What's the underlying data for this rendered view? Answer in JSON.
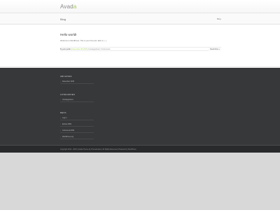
{
  "header": {
    "logo_main": "Avad",
    "logo_accent": "a"
  },
  "page_title_bar": {
    "title": "Blog",
    "breadcrumb": "Blog"
  },
  "post": {
    "title": "Hello world!",
    "excerpt": "Welcome to WordPress. This is your first post. Edit or [...]",
    "meta_author": "By jacki jacklin",
    "meta_date": "| December 4th 2015",
    "meta_category": "| Uncategorized",
    "meta_comments": "| 0 Comments",
    "read_more": "Read More »"
  },
  "footer": {
    "archives": {
      "title": "ARCHIVES",
      "items": [
        "December 2015"
      ]
    },
    "categories": {
      "title": "CATEGORIES",
      "items": [
        "Uncategorized"
      ]
    },
    "meta": {
      "title": "META",
      "items": [
        "Log in",
        "Entries RSS",
        "Comments RSS",
        "WordPress.org"
      ]
    }
  },
  "copyright": "Copyright 2012 - 2015 | Avada Theme by ThemeFusion | All Rights Reserved | Powered by WordPress"
}
